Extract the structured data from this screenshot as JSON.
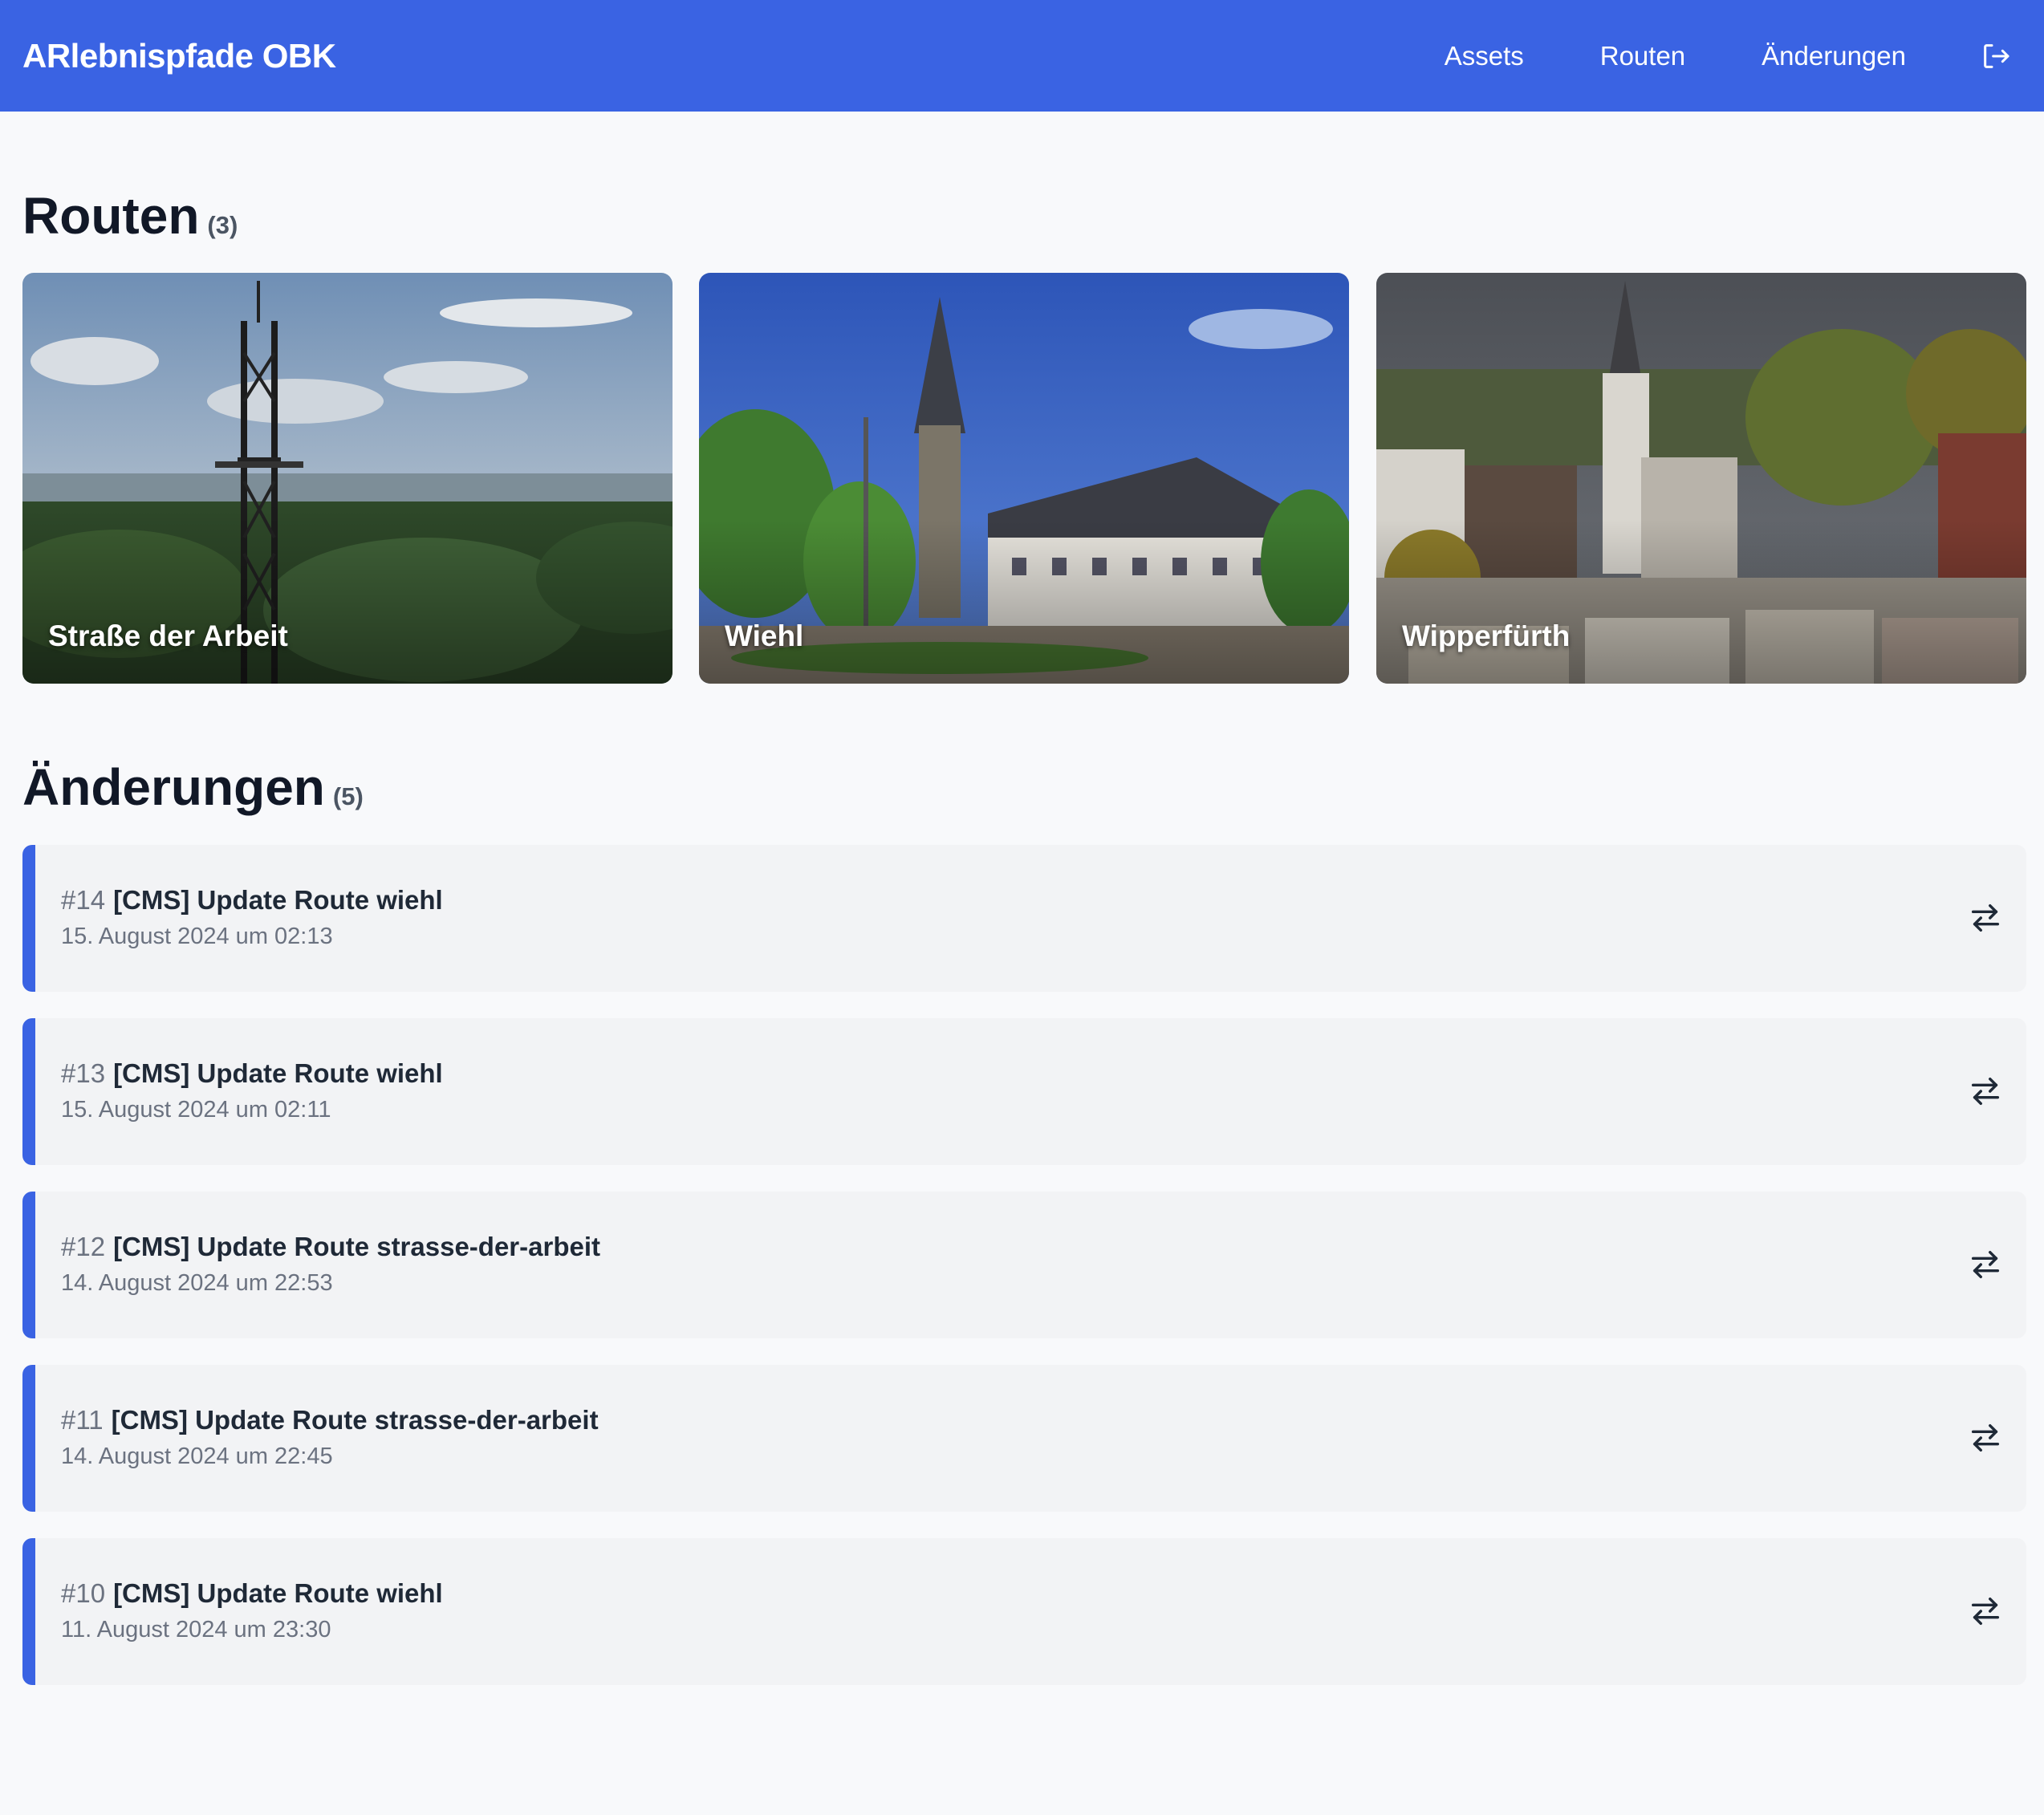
{
  "header": {
    "brand": "ARlebnispfade OBK",
    "nav": [
      "Assets",
      "Routen",
      "Änderungen"
    ],
    "logout_icon": "logout-icon"
  },
  "routes": {
    "title": "Routen",
    "count": "(3)",
    "items": [
      {
        "label": "Straße der Arbeit"
      },
      {
        "label": "Wiehl"
      },
      {
        "label": "Wipperfürth"
      }
    ]
  },
  "changes": {
    "title": "Änderungen",
    "count": "(5)",
    "items": [
      {
        "num": "#14",
        "title": "[CMS] Update Route wiehl",
        "date": "15. August 2024 um 02:13"
      },
      {
        "num": "#13",
        "title": "[CMS] Update Route wiehl",
        "date": "15. August 2024 um 02:11"
      },
      {
        "num": "#12",
        "title": "[CMS] Update Route strasse-der-arbeit",
        "date": "14. August 2024 um 22:53"
      },
      {
        "num": "#11",
        "title": "[CMS] Update Route strasse-der-arbeit",
        "date": "14. August 2024 um 22:45"
      },
      {
        "num": "#10",
        "title": "[CMS] Update Route wiehl",
        "date": "11. August 2024 um 23:30"
      }
    ],
    "action_icon": "swap-arrows-icon"
  },
  "colors": {
    "primary": "#3a63e3",
    "background": "#f8f9fb",
    "row_background": "#f2f3f5"
  }
}
